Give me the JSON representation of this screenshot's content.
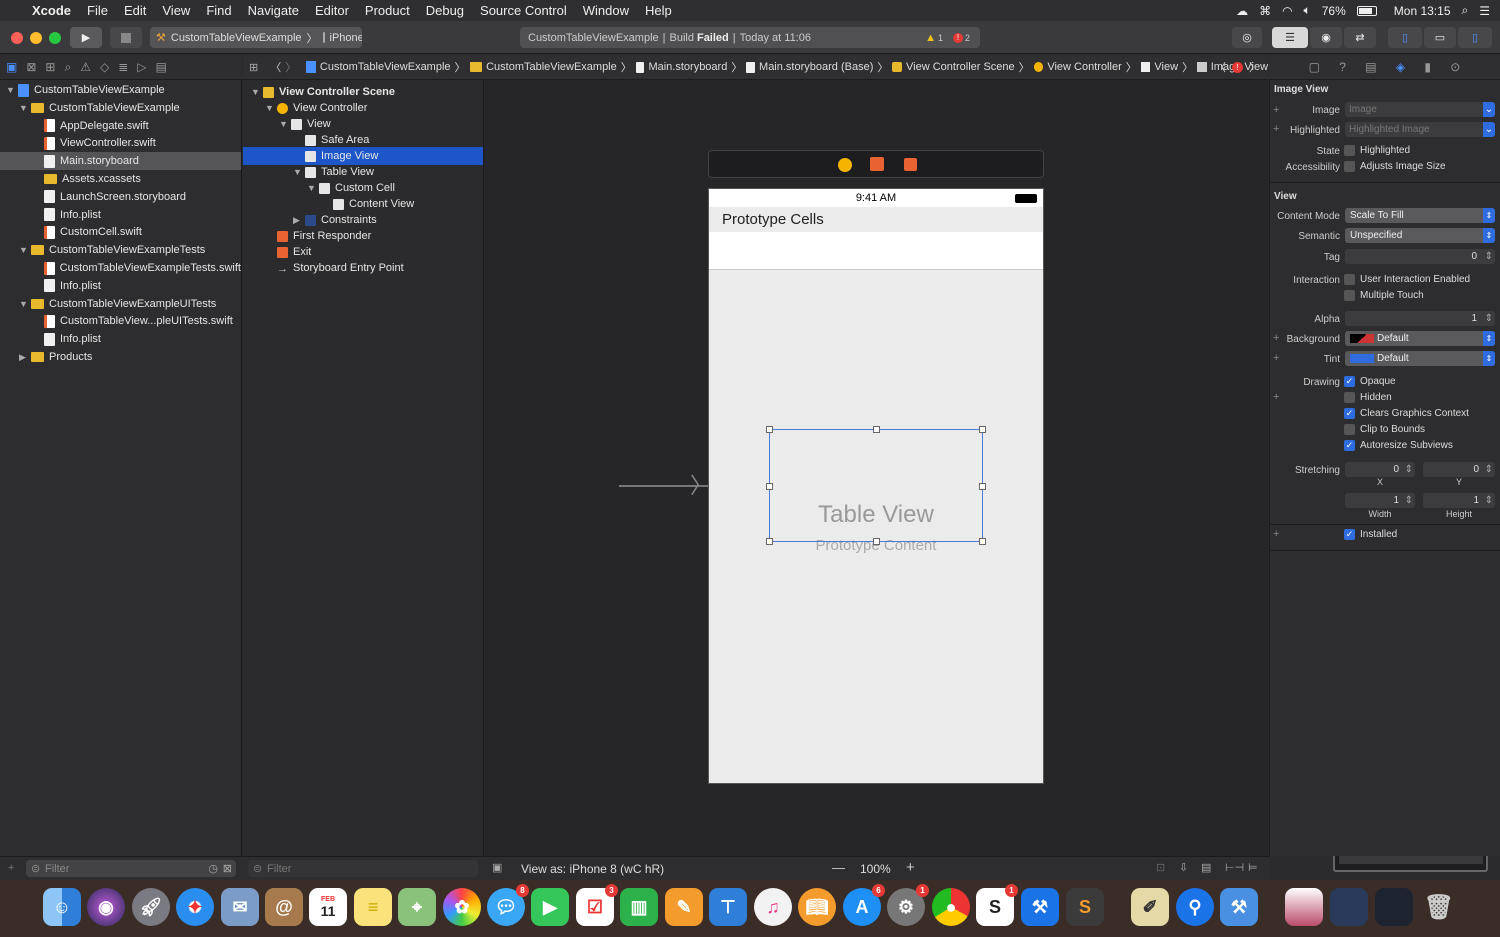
{
  "menubar": {
    "app": "Xcode",
    "items": [
      "File",
      "Edit",
      "View",
      "Find",
      "Navigate",
      "Editor",
      "Product",
      "Debug",
      "Source Control",
      "Window",
      "Help"
    ],
    "battery": "76%",
    "clock": "Mon 13:15"
  },
  "toolbar": {
    "scheme": "CustomTableViewExample",
    "device": "iPhone",
    "activity_project": "CustomTableViewExample",
    "activity_build": "Build",
    "activity_status": "Failed",
    "activity_time": "Today at 11:06",
    "warnings": "1",
    "errors": "2"
  },
  "navigator": {
    "items": [
      {
        "label": "CustomTableViewExample",
        "indent": 0,
        "kind": "project",
        "open": true
      },
      {
        "label": "CustomTableViewExample",
        "indent": 1,
        "kind": "folder",
        "open": true
      },
      {
        "label": "AppDelegate.swift",
        "indent": 2,
        "kind": "swift"
      },
      {
        "label": "ViewController.swift",
        "indent": 2,
        "kind": "swift"
      },
      {
        "label": "Main.storyboard",
        "indent": 2,
        "kind": "file",
        "selected": true
      },
      {
        "label": "Assets.xcassets",
        "indent": 2,
        "kind": "folder"
      },
      {
        "label": "LaunchScreen.storyboard",
        "indent": 2,
        "kind": "file"
      },
      {
        "label": "Info.plist",
        "indent": 2,
        "kind": "file"
      },
      {
        "label": "CustomCell.swift",
        "indent": 2,
        "kind": "swift"
      },
      {
        "label": "CustomTableViewExampleTests",
        "indent": 1,
        "kind": "folder",
        "open": true
      },
      {
        "label": "CustomTableViewExampleTests.swift",
        "indent": 2,
        "kind": "swift"
      },
      {
        "label": "Info.plist",
        "indent": 2,
        "kind": "file"
      },
      {
        "label": "CustomTableViewExampleUITests",
        "indent": 1,
        "kind": "folder",
        "open": true
      },
      {
        "label": "CustomTableView...pleUITests.swift",
        "indent": 2,
        "kind": "swift"
      },
      {
        "label": "Info.plist",
        "indent": 2,
        "kind": "file"
      },
      {
        "label": "Products",
        "indent": 1,
        "kind": "folder",
        "open": false
      }
    ],
    "filter_placeholder": "Filter"
  },
  "jumpbar": {
    "crumbs": [
      "CustomTableViewExample",
      "CustomTableViewExample",
      "Main.storyboard",
      "Main.storyboard (Base)",
      "View Controller Scene",
      "View Controller",
      "View",
      "Image View"
    ]
  },
  "outline": {
    "items": [
      {
        "label": "View Controller Scene",
        "indent": 0,
        "bold": true,
        "tri": "▼"
      },
      {
        "label": "View Controller",
        "indent": 1,
        "tri": "▼"
      },
      {
        "label": "View",
        "indent": 2,
        "tri": "▼"
      },
      {
        "label": "Safe Area",
        "indent": 3,
        "tri": ""
      },
      {
        "label": "Image View",
        "indent": 3,
        "tri": "",
        "selected": true
      },
      {
        "label": "Table View",
        "indent": 3,
        "tri": "▼"
      },
      {
        "label": "Custom Cell",
        "indent": 4,
        "tri": "▼"
      },
      {
        "label": "Content View",
        "indent": 5,
        "tri": ""
      },
      {
        "label": "Constraints",
        "indent": 3,
        "tri": "▶"
      },
      {
        "label": "First Responder",
        "indent": 1,
        "tri": ""
      },
      {
        "label": "Exit",
        "indent": 1,
        "tri": ""
      },
      {
        "label": "Storyboard Entry Point",
        "indent": 1,
        "tri": ""
      }
    ],
    "filter_placeholder": "Filter"
  },
  "canvas": {
    "status_time": "9:41 AM",
    "section_header": "Prototype Cells",
    "table_title": "Table View",
    "table_subtitle": "Prototype Content",
    "view_as": "View as: iPhone 8 (wC hR)",
    "zoom": "100%",
    "zoom_minus": "—",
    "zoom_plus": "+"
  },
  "inspector": {
    "image_view_section": "Image View",
    "image_label": "Image",
    "image_placeholder": "Image",
    "highlighted_label": "Highlighted",
    "highlighted_placeholder": "Highlighted Image",
    "state_label": "State",
    "state_value": "Highlighted",
    "accessibility_label": "Accessibility",
    "accessibility_value": "Adjusts Image Size",
    "view_section": "View",
    "content_mode_label": "Content Mode",
    "content_mode_value": "Scale To Fill",
    "semantic_label": "Semantic",
    "semantic_value": "Unspecified",
    "tag_label": "Tag",
    "tag_value": "0",
    "interaction_label": "Interaction",
    "user_interaction": "User Interaction Enabled",
    "multiple_touch": "Multiple Touch",
    "alpha_label": "Alpha",
    "alpha_value": "1",
    "background_label": "Background",
    "background_value": "Default",
    "tint_label": "Tint",
    "tint_value": "Default",
    "drawing_label": "Drawing",
    "opaque": "Opaque",
    "hidden": "Hidden",
    "clears": "Clears Graphics Context",
    "clip": "Clip to Bounds",
    "autoresize": "Autoresize Subviews",
    "stretching_label": "Stretching",
    "stretch_x": "0",
    "stretch_y": "0",
    "x_label": "X",
    "y_label": "Y",
    "stretch_w": "1",
    "stretch_h": "1",
    "width_label": "Width",
    "height_label": "Height",
    "installed": "Installed"
  },
  "dock": {
    "badges": {
      "messages": "8",
      "reminders": "3",
      "appstore": "6",
      "prefs": "1",
      "sublime": "1"
    },
    "calendar_month": "FEB",
    "calendar_day": "11"
  },
  "colors": {
    "accent": "#2e6ce0",
    "selection": "#1d56c8",
    "error": "#e53935",
    "warning": "#f5c518"
  }
}
